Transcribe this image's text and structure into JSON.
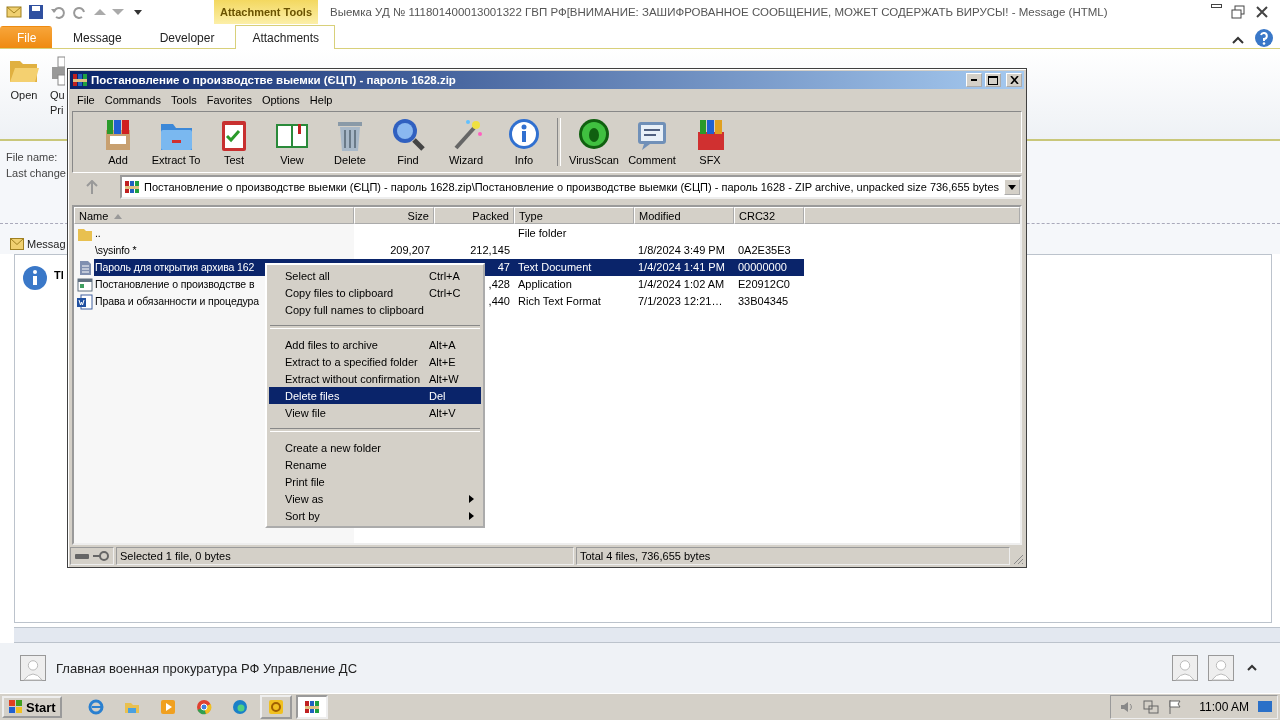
{
  "outlook": {
    "title": "Выемка УД № 111801400013001322  ГВП РФ[ВНИМАНИЕ: ЗАШИФРОВАННОЕ СООБЩЕНИЕ, МОЖЕТ СОДЕРЖАТЬ ВИРУСЫ!  -  Message (HTML)",
    "tool_group": "Attachment Tools",
    "tabs": [
      {
        "label": "File",
        "kind": "file",
        "selected": false
      },
      {
        "label": "Message",
        "kind": "tab",
        "selected": false
      },
      {
        "label": "Developer",
        "kind": "tab",
        "selected": false
      },
      {
        "label": "Attachments",
        "kind": "tab",
        "selected": true
      }
    ],
    "ribbon_buttons": [
      {
        "lines": [
          "Open"
        ]
      },
      {
        "lines": [
          "Qu",
          "Pri"
        ]
      }
    ],
    "fields": [
      "File name:",
      "Last change"
    ],
    "message_tab": "Messag",
    "info_text": "Tl",
    "sender": "Главная военная прокуратура РФ Управление ДС"
  },
  "winrar": {
    "title": "Постановление о производстве выемки (ЄЦП) - пароль 1628.zip",
    "menu": [
      "File",
      "Commands",
      "Tools",
      "Favorites",
      "Options",
      "Help"
    ],
    "toolbar": [
      "Add",
      "Extract To",
      "Test",
      "View",
      "Delete",
      "Find",
      "Wizard",
      "Info",
      "VirusScan",
      "Comment",
      "SFX"
    ],
    "path": "Постановление о производстве выемки (ЄЦП) - пароль 1628.zip\\Постановление о производстве выемки (ЄЦП) - пароль 1628 - ZIP archive, unpacked size 736,655 bytes",
    "columns": [
      {
        "label": "Name",
        "sorted": true
      },
      {
        "label": "Size",
        "sorted": false
      },
      {
        "label": "Packed",
        "sorted": false
      },
      {
        "label": "Type",
        "sorted": false
      },
      {
        "label": "Modified",
        "sorted": false
      },
      {
        "label": "CRC32",
        "sorted": false
      }
    ],
    "rows": [
      {
        "kind": "folder",
        "name": "..",
        "type": "File folder",
        "selected": false
      },
      {
        "kind": "blank",
        "name": "\\sysinfo *",
        "size": "209,207",
        "packed": "212,145",
        "modified": "1/8/2024 3:49 PM",
        "crc": "0A2E35E3",
        "selected": false
      },
      {
        "kind": "text",
        "name": "Пароль для открытия архива 162",
        "packed": "47",
        "type": "Text Document",
        "modified": "1/4/2024 1:41 PM",
        "crc": "00000000",
        "selected": true
      },
      {
        "kind": "app",
        "name": "Постановление о производстве в",
        "packed": ",428",
        "type": "Application",
        "modified": "1/4/2024 1:02 AM",
        "crc": "E20912C0",
        "selected": false
      },
      {
        "kind": "rtf",
        "name": "Права и обязанности и процедура",
        "packed": ",440",
        "type": "Rich Text Format",
        "modified": "7/1/2023 12:21…",
        "crc": "33B04345",
        "selected": false
      }
    ],
    "status_left": "Selected 1 file, 0 bytes",
    "status_right": "Total 4 files, 736,655 bytes"
  },
  "context_menu": {
    "items": [
      {
        "kind": "item",
        "label": "Select all",
        "shortcut": "Ctrl+A",
        "submenu": false,
        "selected": false
      },
      {
        "kind": "item",
        "label": "Copy files to clipboard",
        "shortcut": "Ctrl+C",
        "submenu": false,
        "selected": false
      },
      {
        "kind": "item",
        "label": "Copy full names to clipboard",
        "submenu": false,
        "selected": false
      },
      {
        "kind": "separator"
      },
      {
        "kind": "item",
        "label": "Add files to archive",
        "shortcut": "Alt+A",
        "submenu": false,
        "selected": false
      },
      {
        "kind": "item",
        "label": "Extract to a specified folder",
        "shortcut": "Alt+E",
        "submenu": false,
        "selected": false
      },
      {
        "kind": "item",
        "label": "Extract without confirmation",
        "shortcut": "Alt+W",
        "submenu": false,
        "selected": false
      },
      {
        "kind": "item",
        "label": "Delete files",
        "shortcut": "Del",
        "submenu": false,
        "selected": true
      },
      {
        "kind": "item",
        "label": "View file",
        "shortcut": "Alt+V",
        "submenu": false,
        "selected": false
      },
      {
        "kind": "separator"
      },
      {
        "kind": "item",
        "label": "Create a new folder",
        "submenu": false,
        "selected": false
      },
      {
        "kind": "item",
        "label": "Rename",
        "submenu": false,
        "selected": false
      },
      {
        "kind": "item",
        "label": "Print file",
        "submenu": false,
        "selected": false
      },
      {
        "kind": "item",
        "label": "View as",
        "submenu": true,
        "selected": false
      },
      {
        "kind": "item",
        "label": "Sort by",
        "submenu": true,
        "selected": false
      }
    ]
  },
  "taskbar": {
    "start": "Start",
    "clock": "11:00 AM",
    "apps": [
      {
        "kind": "ie",
        "open": false,
        "selected": false
      },
      {
        "kind": "explorer",
        "open": false,
        "selected": false
      },
      {
        "kind": "media",
        "open": false,
        "selected": false
      },
      {
        "kind": "chrome",
        "open": false,
        "selected": false
      },
      {
        "kind": "edge",
        "open": false,
        "selected": false
      },
      {
        "kind": "outlook",
        "open": true,
        "selected": false
      },
      {
        "kind": "winrar",
        "open": true,
        "selected": true
      }
    ]
  }
}
